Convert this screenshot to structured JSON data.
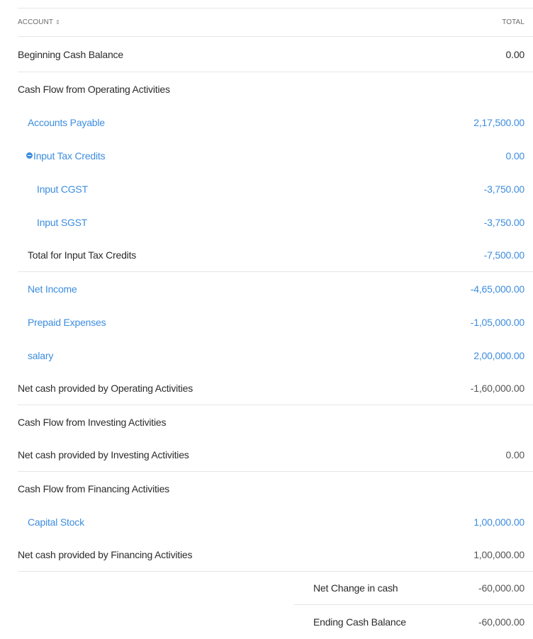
{
  "header": {
    "account_label": "ACCOUNT",
    "sort_icon": "sort-arrows-icon",
    "total_label": "TOTAL"
  },
  "rows": {
    "beginning": {
      "label": "Beginning Cash Balance",
      "amount": "0.00"
    },
    "operating_heading": {
      "label": "Cash Flow from Operating Activities"
    },
    "accounts_payable": {
      "label": "Accounts Payable",
      "amount": "2,17,500.00"
    },
    "input_tax_credits": {
      "label": "Input Tax Credits",
      "amount": "0.00",
      "icon": "collapse-icon"
    },
    "input_cgst": {
      "label": "Input CGST",
      "amount": "-3,750.00"
    },
    "input_sgst": {
      "label": "Input SGST",
      "amount": "-3,750.00"
    },
    "total_itc": {
      "label": "Total for Input Tax Credits",
      "amount": "-7,500.00"
    },
    "net_income": {
      "label": "Net Income",
      "amount": "-4,65,000.00"
    },
    "prepaid": {
      "label": "Prepaid Expenses",
      "amount": "-1,05,000.00"
    },
    "salary": {
      "label": "salary",
      "amount": "2,00,000.00"
    },
    "net_operating": {
      "label": "Net cash provided by Operating Activities",
      "amount": "-1,60,000.00"
    },
    "investing_heading": {
      "label": "Cash Flow from Investing Activities"
    },
    "net_investing": {
      "label": "Net cash provided by Investing Activities",
      "amount": "0.00"
    },
    "financing_heading": {
      "label": "Cash Flow from Financing Activities"
    },
    "capital_stock": {
      "label": "Capital Stock",
      "amount": "1,00,000.00"
    },
    "net_financing": {
      "label": "Net cash provided by Financing Activities",
      "amount": "1,00,000.00"
    },
    "net_change": {
      "label": "Net Change in cash",
      "amount": "-60,000.00"
    },
    "ending": {
      "label": "Ending Cash Balance",
      "amount": "-60,000.00"
    }
  },
  "colors": {
    "link": "#3d8ddf",
    "text": "#2b2b2b",
    "divider": "#e6e6e6"
  }
}
